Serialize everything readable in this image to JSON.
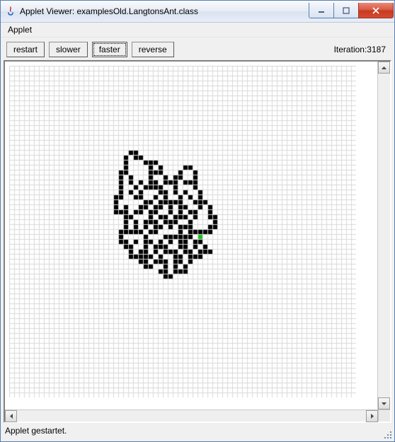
{
  "window": {
    "title": "Applet Viewer: examplesOld.LangtonsAnt.class"
  },
  "menu": {
    "applet": "Applet"
  },
  "toolbar": {
    "restart": "restart",
    "slower": "slower",
    "faster": "faster",
    "reverse": "reverse"
  },
  "iteration": {
    "label": "Iteration:",
    "value": "3187"
  },
  "status": {
    "text": "Applet gestartet."
  },
  "grid": {
    "cellSize": 7,
    "cols": 70,
    "rows": 67,
    "colors": {
      "bg": "#ffffff",
      "line": "#d9d9d9",
      "cell": "#000000",
      "ant": "#17c21a"
    },
    "ant": [
      38,
      34
    ],
    "black": [
      [
        24,
        17
      ],
      [
        25,
        17
      ],
      [
        23,
        18
      ],
      [
        25,
        18
      ],
      [
        26,
        18
      ],
      [
        23,
        19
      ],
      [
        27,
        19
      ],
      [
        28,
        19
      ],
      [
        29,
        19
      ],
      [
        23,
        20
      ],
      [
        28,
        20
      ],
      [
        30,
        20
      ],
      [
        35,
        20
      ],
      [
        36,
        20
      ],
      [
        22,
        21
      ],
      [
        23,
        21
      ],
      [
        28,
        21
      ],
      [
        29,
        21
      ],
      [
        30,
        21
      ],
      [
        34,
        21
      ],
      [
        37,
        21
      ],
      [
        22,
        22
      ],
      [
        24,
        22
      ],
      [
        28,
        22
      ],
      [
        31,
        22
      ],
      [
        33,
        22
      ],
      [
        34,
        22
      ],
      [
        37,
        22
      ],
      [
        22,
        23
      ],
      [
        24,
        23
      ],
      [
        26,
        23
      ],
      [
        28,
        23
      ],
      [
        29,
        23
      ],
      [
        31,
        23
      ],
      [
        32,
        23
      ],
      [
        33,
        23
      ],
      [
        35,
        23
      ],
      [
        36,
        23
      ],
      [
        37,
        23
      ],
      [
        22,
        24
      ],
      [
        25,
        24
      ],
      [
        27,
        24
      ],
      [
        28,
        24
      ],
      [
        29,
        24
      ],
      [
        30,
        24
      ],
      [
        33,
        24
      ],
      [
        37,
        24
      ],
      [
        22,
        25
      ],
      [
        24,
        25
      ],
      [
        26,
        25
      ],
      [
        30,
        25
      ],
      [
        31,
        25
      ],
      [
        33,
        25
      ],
      [
        35,
        25
      ],
      [
        38,
        25
      ],
      [
        21,
        26
      ],
      [
        22,
        26
      ],
      [
        25,
        26
      ],
      [
        26,
        26
      ],
      [
        29,
        26
      ],
      [
        31,
        26
      ],
      [
        34,
        26
      ],
      [
        36,
        26
      ],
      [
        38,
        26
      ],
      [
        21,
        27
      ],
      [
        27,
        27
      ],
      [
        28,
        27
      ],
      [
        30,
        27
      ],
      [
        31,
        27
      ],
      [
        32,
        27
      ],
      [
        33,
        27
      ],
      [
        34,
        27
      ],
      [
        37,
        27
      ],
      [
        38,
        27
      ],
      [
        39,
        27
      ],
      [
        21,
        28
      ],
      [
        23,
        28
      ],
      [
        26,
        28
      ],
      [
        27,
        28
      ],
      [
        29,
        28
      ],
      [
        30,
        28
      ],
      [
        32,
        28
      ],
      [
        34,
        28
      ],
      [
        35,
        28
      ],
      [
        38,
        28
      ],
      [
        40,
        28
      ],
      [
        21,
        29
      ],
      [
        22,
        29
      ],
      [
        23,
        29
      ],
      [
        25,
        29
      ],
      [
        26,
        29
      ],
      [
        28,
        29
      ],
      [
        29,
        29
      ],
      [
        32,
        29
      ],
      [
        34,
        29
      ],
      [
        36,
        29
      ],
      [
        37,
        29
      ],
      [
        40,
        29
      ],
      [
        23,
        30
      ],
      [
        24,
        30
      ],
      [
        28,
        30
      ],
      [
        30,
        30
      ],
      [
        31,
        30
      ],
      [
        33,
        30
      ],
      [
        34,
        30
      ],
      [
        35,
        30
      ],
      [
        37,
        30
      ],
      [
        40,
        30
      ],
      [
        41,
        30
      ],
      [
        23,
        31
      ],
      [
        25,
        31
      ],
      [
        27,
        31
      ],
      [
        28,
        31
      ],
      [
        29,
        31
      ],
      [
        31,
        31
      ],
      [
        32,
        31
      ],
      [
        33,
        31
      ],
      [
        36,
        31
      ],
      [
        41,
        31
      ],
      [
        23,
        32
      ],
      [
        25,
        32
      ],
      [
        27,
        32
      ],
      [
        29,
        32
      ],
      [
        30,
        32
      ],
      [
        32,
        32
      ],
      [
        34,
        32
      ],
      [
        35,
        32
      ],
      [
        36,
        32
      ],
      [
        40,
        32
      ],
      [
        41,
        32
      ],
      [
        22,
        33
      ],
      [
        23,
        33
      ],
      [
        24,
        33
      ],
      [
        25,
        33
      ],
      [
        26,
        33
      ],
      [
        28,
        33
      ],
      [
        29,
        33
      ],
      [
        34,
        33
      ],
      [
        36,
        33
      ],
      [
        37,
        33
      ],
      [
        38,
        33
      ],
      [
        39,
        33
      ],
      [
        40,
        33
      ],
      [
        22,
        34
      ],
      [
        27,
        34
      ],
      [
        31,
        34
      ],
      [
        32,
        34
      ],
      [
        33,
        34
      ],
      [
        34,
        34
      ],
      [
        35,
        34
      ],
      [
        36,
        34
      ],
      [
        22,
        35
      ],
      [
        23,
        35
      ],
      [
        25,
        35
      ],
      [
        27,
        35
      ],
      [
        28,
        35
      ],
      [
        30,
        35
      ],
      [
        32,
        35
      ],
      [
        34,
        35
      ],
      [
        35,
        35
      ],
      [
        37,
        35
      ],
      [
        38,
        35
      ],
      [
        23,
        36
      ],
      [
        24,
        36
      ],
      [
        27,
        36
      ],
      [
        29,
        36
      ],
      [
        30,
        36
      ],
      [
        31,
        36
      ],
      [
        34,
        36
      ],
      [
        35,
        36
      ],
      [
        37,
        36
      ],
      [
        39,
        36
      ],
      [
        24,
        37
      ],
      [
        26,
        37
      ],
      [
        27,
        37
      ],
      [
        29,
        37
      ],
      [
        31,
        37
      ],
      [
        32,
        37
      ],
      [
        33,
        37
      ],
      [
        35,
        37
      ],
      [
        36,
        37
      ],
      [
        38,
        37
      ],
      [
        39,
        37
      ],
      [
        40,
        37
      ],
      [
        24,
        38
      ],
      [
        25,
        38
      ],
      [
        26,
        38
      ],
      [
        27,
        38
      ],
      [
        28,
        38
      ],
      [
        30,
        38
      ],
      [
        33,
        38
      ],
      [
        34,
        38
      ],
      [
        36,
        38
      ],
      [
        37,
        38
      ],
      [
        38,
        38
      ],
      [
        26,
        39
      ],
      [
        27,
        39
      ],
      [
        29,
        39
      ],
      [
        30,
        39
      ],
      [
        31,
        39
      ],
      [
        33,
        39
      ],
      [
        34,
        39
      ],
      [
        36,
        39
      ],
      [
        27,
        40
      ],
      [
        28,
        40
      ],
      [
        31,
        40
      ],
      [
        33,
        40
      ],
      [
        35,
        40
      ],
      [
        30,
        41
      ],
      [
        31,
        41
      ],
      [
        33,
        41
      ],
      [
        34,
        41
      ],
      [
        35,
        41
      ],
      [
        31,
        42
      ],
      [
        32,
        42
      ]
    ]
  }
}
